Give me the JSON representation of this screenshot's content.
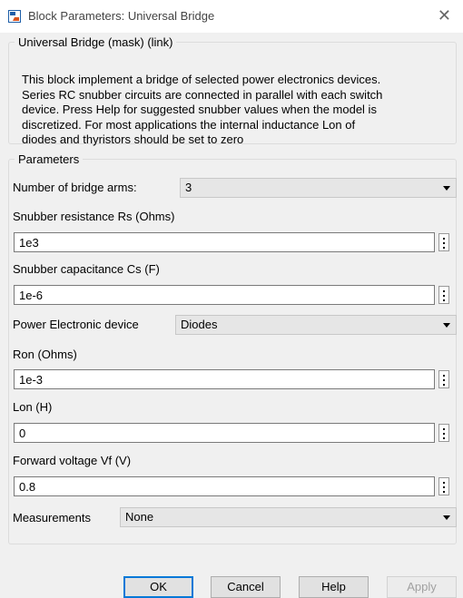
{
  "window": {
    "title": "Block Parameters: Universal Bridge",
    "close_icon": "close-icon",
    "app_icon": "simulink-block-icon"
  },
  "mask": {
    "legend": "Universal Bridge (mask) (link)",
    "description_lines": [
      "This block implement a bridge of selected power electronics devices.",
      "Series RC snubber circuits are connected in parallel with each switch",
      "device.  Press Help for suggested snubber values when the model is",
      "discretized. For most applications the internal inductance Lon of",
      "diodes and thyristors should be set to zero"
    ]
  },
  "parameters": {
    "legend": "Parameters",
    "bridge_arms": {
      "label": "Number of bridge arms:",
      "value": "3"
    },
    "rs": {
      "label": "Snubber resistance Rs (Ohms)",
      "value": "1e3"
    },
    "cs": {
      "label": "Snubber capacitance Cs (F)",
      "value": "1e-6"
    },
    "device": {
      "label": "Power Electronic device",
      "value": "Diodes"
    },
    "ron": {
      "label": "Ron (Ohms)",
      "value": "1e-3"
    },
    "lon": {
      "label": "Lon (H)",
      "value": "0"
    },
    "vf": {
      "label": "Forward voltage Vf (V)",
      "value": "0.8"
    },
    "measurements": {
      "label": "Measurements",
      "value": "None"
    }
  },
  "buttons": {
    "ok": "OK",
    "cancel": "Cancel",
    "help": "Help",
    "apply": "Apply"
  },
  "colors": {
    "dialog_bg": "#f0f0f0",
    "focus_border": "#0078d7",
    "disabled_text": "#a0a0a0"
  }
}
